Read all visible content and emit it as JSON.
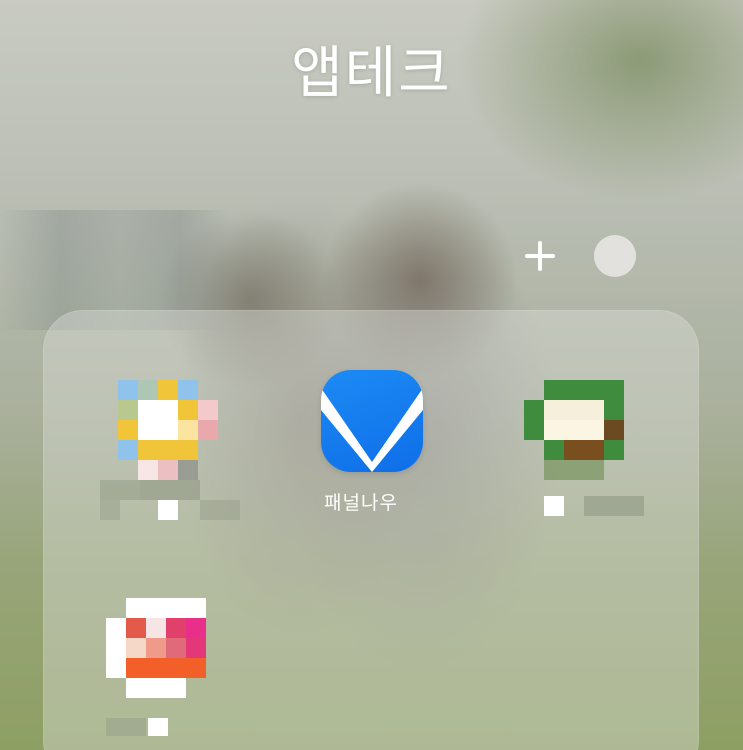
{
  "folder": {
    "title": "앱테크",
    "add_button_icon": "plus-icon",
    "color_button_icon": "circle-icon",
    "color_button_color": "#e3e1dd"
  },
  "apps": [
    {
      "name": "",
      "label": "",
      "icon": "pixelated-app-icon-1"
    },
    {
      "name": "패널나우",
      "label": "패널나우",
      "icon": "checkmark-icon",
      "color": "#1a80f2"
    },
    {
      "name": "",
      "label": "",
      "icon": "pixelated-app-icon-3"
    },
    {
      "name": "",
      "label": "",
      "icon": "pixelated-app-icon-4"
    }
  ]
}
